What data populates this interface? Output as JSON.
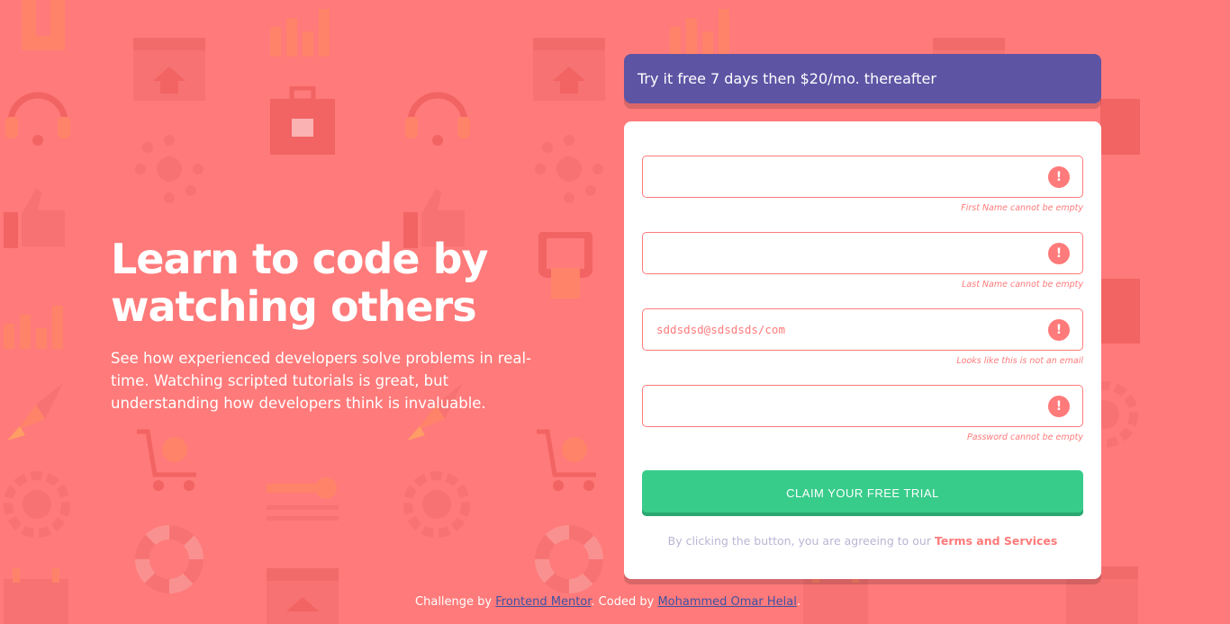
{
  "hero": {
    "title_line1": "Learn to code by",
    "title_line2": "watching others",
    "description": "See how experienced developers solve problems in real-time. Watching scripted tutorials is great, but understanding how developers think is invaluable."
  },
  "promo": {
    "text_prefix": "Try it free 7 days",
    "text_rest": " then $20/mo. thereafter"
  },
  "form": {
    "first_name": {
      "value": "",
      "error": "First Name cannot be empty"
    },
    "last_name": {
      "value": "",
      "error": "Last Name cannot be empty"
    },
    "email": {
      "value": "sddsdsd@sdsdsds/com",
      "error": "Looks like this is not an email"
    },
    "password": {
      "value": "",
      "error": "Password cannot be empty"
    },
    "submit_label": "CLAIM YOUR FREE TRIAL",
    "error_icon_glyph": "!",
    "terms_prefix": "By clicking the button, you are agreeing to our ",
    "terms_link": "Terms and Services"
  },
  "attribution": {
    "prefix": "Challenge by ",
    "challenge_link": "Frontend Mentor",
    "middle": ". Coded by ",
    "author_link": "Mohammed Omar Helal",
    "suffix": "."
  },
  "colors": {
    "background": "#ff7a7a",
    "promo": "#5e54a4",
    "submit": "#38cc8b",
    "error": "#ff7a7a",
    "muted_text": "#b9b6d3"
  },
  "icons": [
    "error-icon",
    "headset-icon",
    "chart-icon",
    "rocket-icon",
    "gear-icon",
    "cart-icon",
    "browser-icon",
    "lifebuoy-icon"
  ]
}
